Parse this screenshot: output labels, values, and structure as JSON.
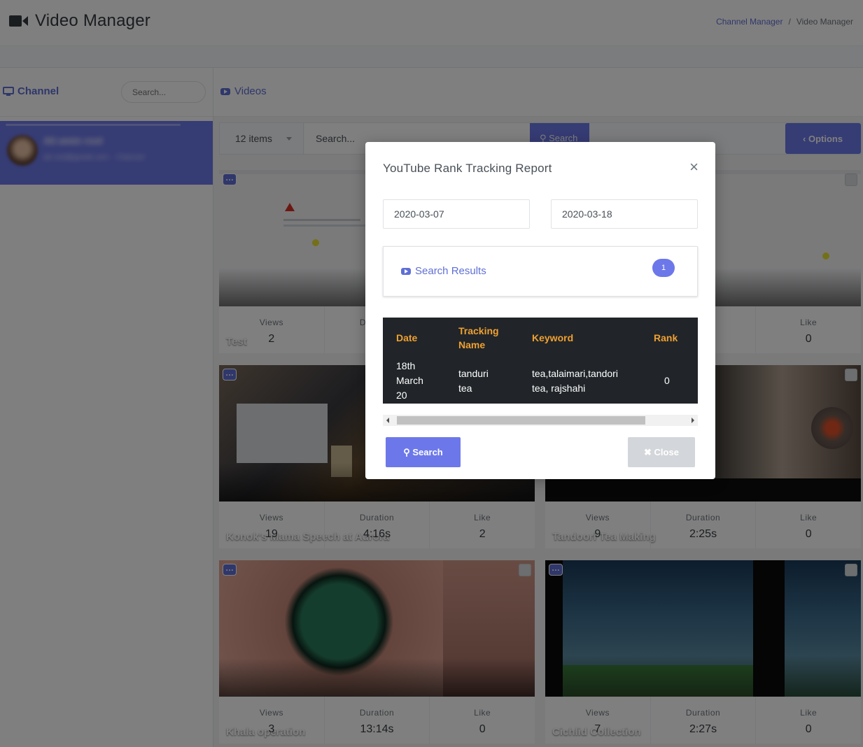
{
  "header": {
    "title": "Video Manager",
    "breadcrumb": [
      "Channel Manager",
      "Video Manager"
    ]
  },
  "channel_panel": {
    "label": "Channel",
    "search_placeholder": "Search...",
    "selected_channel": {
      "name": "Ali amin rool",
      "subtitle": "ali.rool@gmail.com · Channel"
    }
  },
  "videos_panel": {
    "label": "Videos",
    "items_count": "12 items",
    "search_placeholder": "Search...",
    "search_button": "Search",
    "options_button": "Options",
    "stat_labels": {
      "views": "Views",
      "duration": "Duration",
      "like": "Like"
    },
    "cards": [
      {
        "title": "Test",
        "views": "2",
        "duration": "",
        "like": "0"
      },
      {
        "title": "Konok's Mama Speech at Aurora",
        "views": "19",
        "duration": "4:16s",
        "like": "2"
      },
      {
        "title": "Tandoori Tea Making",
        "views": "9",
        "duration": "2:25s",
        "like": "0"
      },
      {
        "title": "Khala operation",
        "views": "3",
        "duration": "13:14s",
        "like": "0"
      },
      {
        "title": "Cichlid Collection",
        "views": "7",
        "duration": "2:27s",
        "like": "0"
      }
    ]
  },
  "modal": {
    "title": "YouTube Rank Tracking Report",
    "close_symbol": "×",
    "start_date": "2020-03-07",
    "end_date": "2020-03-18",
    "results_label": "Search Results",
    "results_count": "1",
    "table": {
      "headers": [
        "Date",
        "Tracking Name",
        "Keyword",
        "Rank"
      ],
      "rows": [
        {
          "date": "18th March 20",
          "name": "tanduri tea",
          "keyword": "tea,talaimari,tandori tea, rajshahi",
          "rank": "0"
        }
      ]
    },
    "search_button": "Search",
    "close_button": "Close"
  },
  "colors": {
    "accent": "#6c78e9",
    "header_orange": "#f0a030",
    "table_dark": "#212529"
  }
}
